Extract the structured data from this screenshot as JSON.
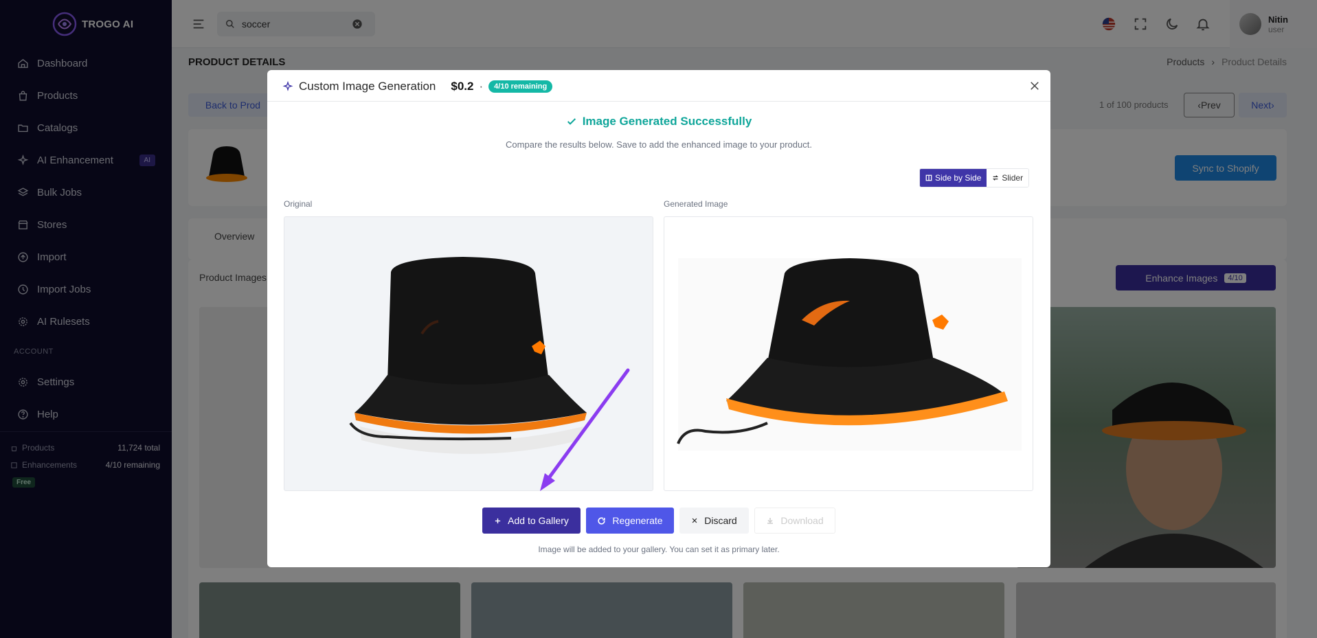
{
  "app": {
    "name": "TROGO AI"
  },
  "sidebar": {
    "items": [
      {
        "label": "Dashboard",
        "icon": "home-icon"
      },
      {
        "label": "Products",
        "icon": "bag-icon"
      },
      {
        "label": "Catalogs",
        "icon": "folder-icon"
      },
      {
        "label": "AI Enhancement",
        "icon": "sparkle-icon",
        "badge": "AI"
      },
      {
        "label": "Bulk Jobs",
        "icon": "layers-icon"
      },
      {
        "label": "Stores",
        "icon": "store-icon"
      },
      {
        "label": "Import",
        "icon": "upload-icon"
      },
      {
        "label": "Import Jobs",
        "icon": "history-icon"
      },
      {
        "label": "AI Rulesets",
        "icon": "gear-icon"
      }
    ],
    "account_label": "ACCOUNT",
    "account_items": [
      {
        "label": "Settings",
        "icon": "gear-icon"
      },
      {
        "label": "Help",
        "icon": "help-icon"
      }
    ],
    "stats": {
      "products_label": "Products",
      "products_value": "11,724 total",
      "enh_label": "Enhancements",
      "enh_value": "4/10 remaining",
      "plan": "Free"
    }
  },
  "topbar": {
    "search_value": "soccer",
    "user_name": "Nitin",
    "user_role": "user"
  },
  "page": {
    "title": "PRODUCT DETAILS",
    "breadcrumb": [
      "Products",
      "Product Details"
    ],
    "back_label": "Back to Prod",
    "pager": "1 of 100 products",
    "prev": "Prev",
    "next": "Next",
    "sync": "Sync to Shopify",
    "tab": "Overview",
    "images_label": "Product Images",
    "enhance": "Enhance Images",
    "enhance_count": "4/10"
  },
  "modal": {
    "title": "Custom Image Generation",
    "price": "$0.2",
    "separator": "·",
    "remaining": "4/10 remaining",
    "success": "Image Generated Successfully",
    "subtitle": "Compare the results below. Save to add the enhanced image to your product.",
    "view_side": "Side by Side",
    "view_slider": "Slider",
    "original_label": "Original",
    "generated_label": "Generated Image",
    "buttons": {
      "add": "Add to Gallery",
      "regen": "Regenerate",
      "discard": "Discard",
      "download": "Download"
    },
    "hint": "Image will be added to your gallery. You can set it as primary later."
  },
  "colors": {
    "accent": "#3b2f9e",
    "success": "#0fa69a",
    "sidebar": "#0f0d2c"
  }
}
